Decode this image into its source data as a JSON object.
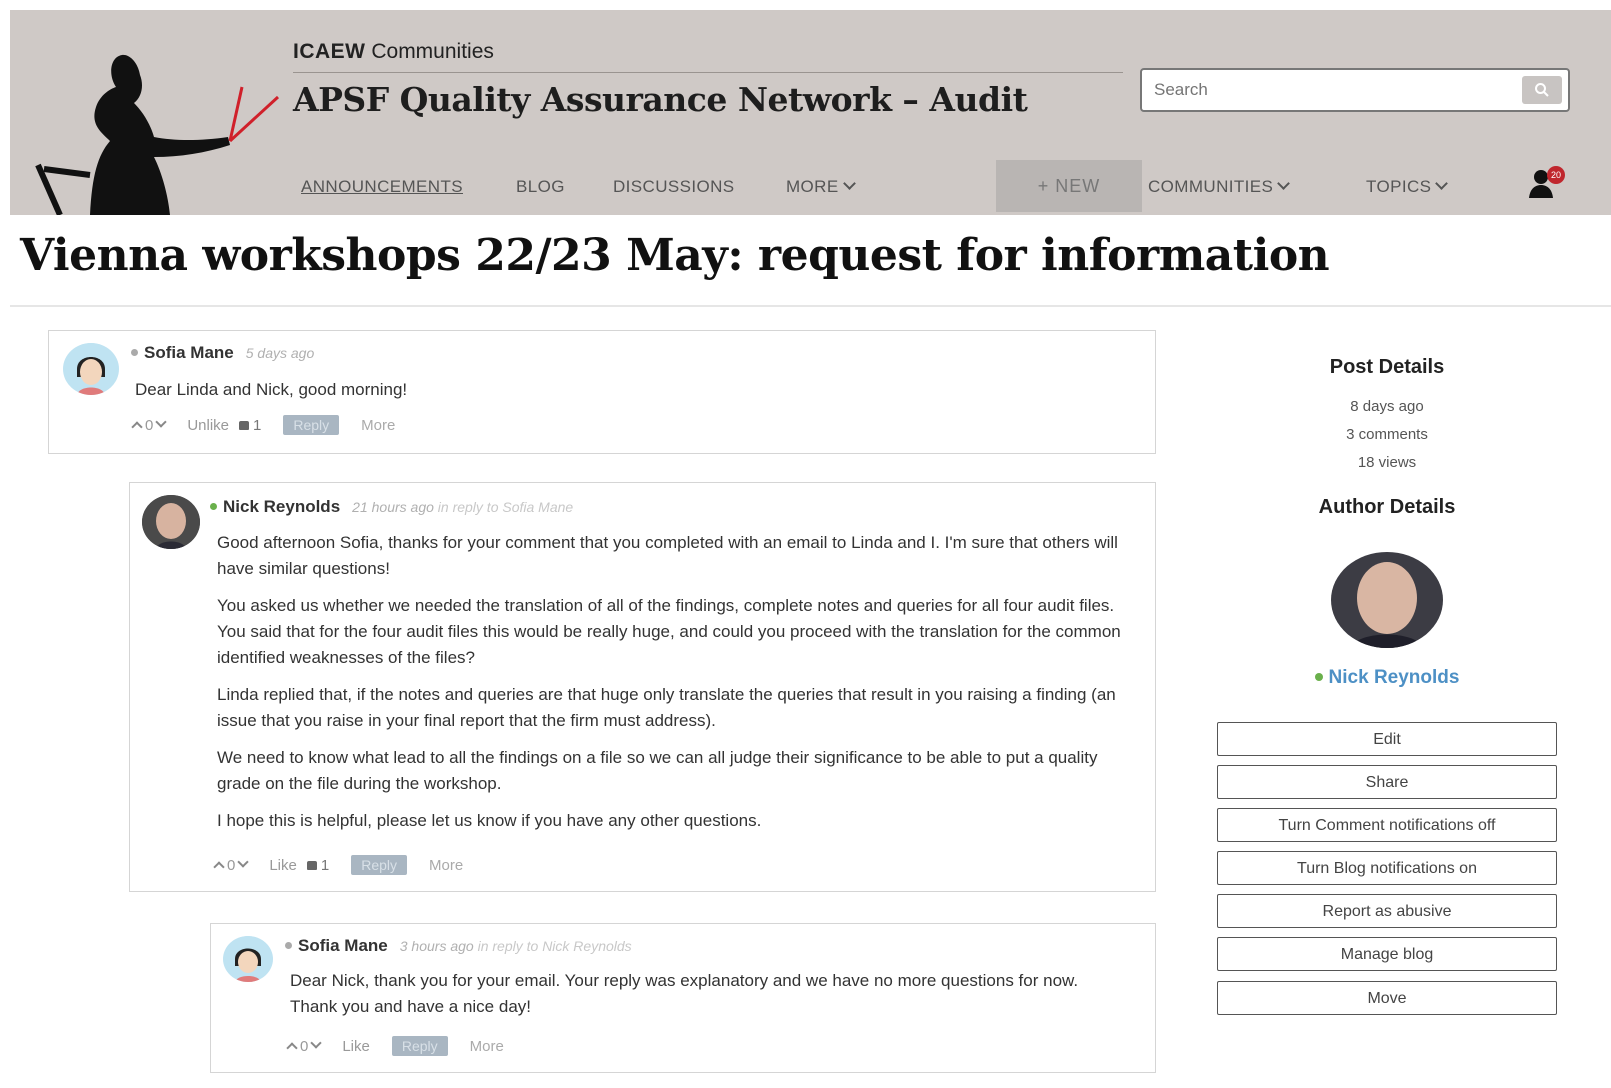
{
  "header": {
    "brand_bold": "ICAEW",
    "brand_light": "Communities",
    "site_title": "APSF Quality Assurance Network – Audit",
    "search_placeholder": "Search",
    "nav": {
      "announcements": "ANNOUNCEMENTS",
      "blog": "BLOG",
      "discussions": "DISCUSSIONS",
      "more": "MORE",
      "new": "+  NEW",
      "communities": "COMMUNITIES",
      "topics": "TOPICS"
    },
    "notification_count": "20",
    "colors": {
      "header_bg": "#cfc9c6",
      "accent_red": "#c0262d"
    }
  },
  "page_title": "Vienna workshops 22/23 May: request for information",
  "comments": [
    {
      "author": "Sofia Mane",
      "time": "5 days ago",
      "in_reply_to": "",
      "paragraphs": [
        "Dear Linda and Nick, good morning!"
      ],
      "votes": "0",
      "like_label": "Unlike",
      "likes": "1",
      "reply_label": "Reply",
      "more_label": "More"
    },
    {
      "author": "Nick Reynolds",
      "time": "21 hours ago",
      "in_reply_prefix": "in reply to",
      "in_reply_to": "Sofia Mane",
      "paragraphs": [
        "Good afternoon Sofia, thanks for your comment that you completed with an email to Linda and I. I'm sure that others will have similar questions!",
        "You asked us whether we needed the translation of all of the findings, complete notes and queries for all four audit files. You said that for the four audit files this would be really huge, and could you proceed with the translation for the common identified weaknesses of the files?",
        "Linda replied that, if the notes and queries are that huge only translate the queries that result in you raising a finding (an issue that you raise in your final report that the firm must address).",
        "We need to know what lead to all the findings on a file so we can all judge their significance to be able to put a quality grade on the file during the workshop.",
        "I hope this is helpful, please let us know if you have any other questions."
      ],
      "votes": "0",
      "like_label": "Like",
      "likes": "1",
      "reply_label": "Reply",
      "more_label": "More"
    },
    {
      "author": "Sofia Mane",
      "time": "3 hours ago",
      "in_reply_prefix": "in reply to",
      "in_reply_to": "Nick Reynolds",
      "paragraphs": [
        "Dear Nick, thank you for your email. Your reply was explanatory and we have no more questions for now. Thank you and have a nice day!"
      ],
      "votes": "0",
      "like_label": "Like",
      "reply_label": "Reply",
      "more_label": "More"
    }
  ],
  "sidebar": {
    "post_details_title": "Post Details",
    "posted": "8 days ago",
    "comments": "3 comments",
    "views": "18 views",
    "author_details_title": "Author Details",
    "author_name": "Nick Reynolds",
    "buttons": [
      "Edit",
      "Share",
      "Turn Comment notifications off",
      "Turn Blog notifications on",
      "Report as abusive",
      "Manage blog",
      "Move"
    ]
  }
}
